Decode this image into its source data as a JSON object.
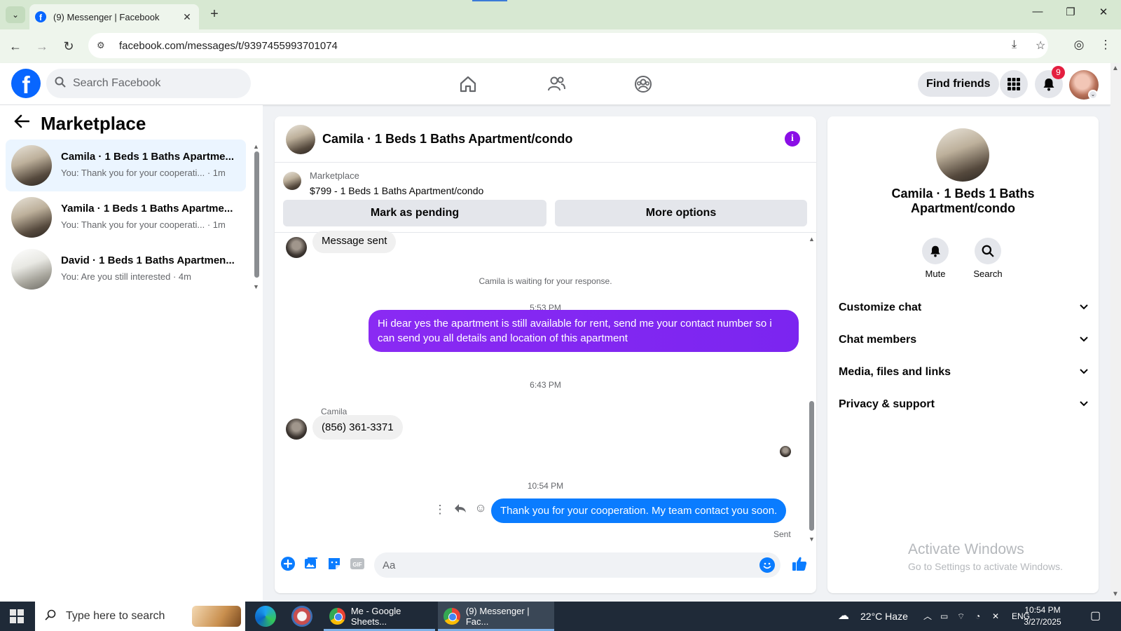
{
  "browser": {
    "tab_title": "(9) Messenger | Facebook",
    "url": "facebook.com/messages/t/9397455993701074"
  },
  "fb_header": {
    "search_placeholder": "Search Facebook",
    "find_friends": "Find friends",
    "notification_count": "9"
  },
  "left_panel": {
    "title": "Marketplace",
    "conversations": [
      {
        "name": "Camila · 1 Beds 1 Baths Apartme...",
        "preview": "You: Thank you for your cooperati... · 1m",
        "active": true
      },
      {
        "name": "Yamila · 1 Beds 1 Baths Apartme...",
        "preview": "You: Thank you for your cooperati... · 1m",
        "active": false
      },
      {
        "name": "David · 1 Beds 1 Baths Apartmen...",
        "preview": "You: Are you still interested · 4m",
        "active": false
      }
    ]
  },
  "chat": {
    "title": "Camila · 1 Beds 1 Baths Apartment/condo",
    "marketplace_label": "Marketplace",
    "listing": "$799 - 1 Beds 1 Baths Apartment/condo",
    "mark_pending": "Mark as pending",
    "more_options": "More options",
    "messages": {
      "msg_sent": "Message sent",
      "waiting": "Camila is waiting for your response.",
      "time1": "5:53 PM",
      "outgoing1": "Hi dear yes the apartment is still available for rent, send me your contact number so i can send you all details and location of this apartment",
      "time2": "6:43 PM",
      "sender": "Camila",
      "incoming_phone": "(856) 361-3371",
      "time3": "10:54 PM",
      "outgoing2": "Thank you for your cooperation. My team contact you soon.",
      "status": "Sent"
    },
    "composer_placeholder": "Aa"
  },
  "right_panel": {
    "name": "Camila · 1 Beds 1 Baths Apartment/condo",
    "mute": "Mute",
    "search": "Search",
    "sections": [
      "Customize chat",
      "Chat members",
      "Media, files and links",
      "Privacy & support"
    ]
  },
  "watermark": {
    "line1": "Activate Windows",
    "line2": "Go to Settings to activate Windows."
  },
  "taskbar": {
    "search_text": "Type here to search",
    "task1": "Me - Google Sheets...",
    "task2": "(9) Messenger | Fac...",
    "weather": "22°C  Haze",
    "lang": "ENG",
    "time": "10:54 PM",
    "date": "3/27/2025"
  },
  "colors": {
    "fb_blue": "#0866ff",
    "messenger_blue": "#0a7cff",
    "purple_bubble": "#8a2af3"
  }
}
